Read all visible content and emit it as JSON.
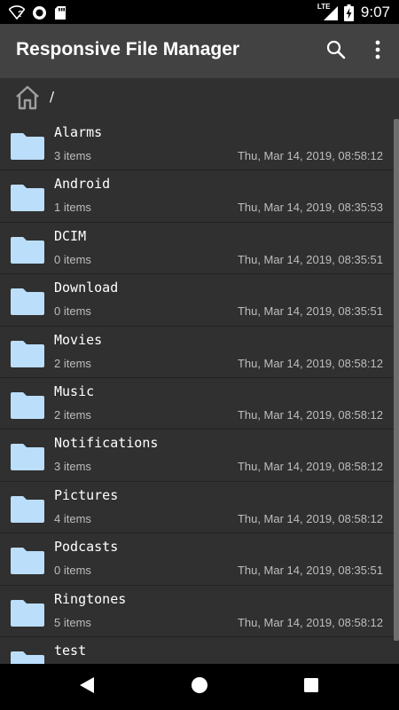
{
  "status_bar": {
    "time": "9:07",
    "network_label": "LTE",
    "wifi_badge": "?",
    "battery_charging": true
  },
  "app_bar": {
    "title": "Responsive File Manager",
    "search_icon": "search-icon",
    "more_icon": "more-vertical-icon"
  },
  "breadcrumb": {
    "home_icon": "home-icon",
    "path": "/"
  },
  "files": [
    {
      "name": "Alarms",
      "count": "3 items",
      "date": "Thu, Mar 14, 2019, 08:58:12"
    },
    {
      "name": "Android",
      "count": "1 items",
      "date": "Thu, Mar 14, 2019, 08:35:53"
    },
    {
      "name": "DCIM",
      "count": "0 items",
      "date": "Thu, Mar 14, 2019, 08:35:51"
    },
    {
      "name": "Download",
      "count": "0 items",
      "date": "Thu, Mar 14, 2019, 08:35:51"
    },
    {
      "name": "Movies",
      "count": "2 items",
      "date": "Thu, Mar 14, 2019, 08:58:12"
    },
    {
      "name": "Music",
      "count": "2 items",
      "date": "Thu, Mar 14, 2019, 08:58:12"
    },
    {
      "name": "Notifications",
      "count": "3 items",
      "date": "Thu, Mar 14, 2019, 08:58:12"
    },
    {
      "name": "Pictures",
      "count": "4 items",
      "date": "Thu, Mar 14, 2019, 08:58:12"
    },
    {
      "name": "Podcasts",
      "count": "0 items",
      "date": "Thu, Mar 14, 2019, 08:35:51"
    },
    {
      "name": "Ringtones",
      "count": "5 items",
      "date": "Thu, Mar 14, 2019, 08:58:12"
    },
    {
      "name": "test",
      "count": "",
      "date": ""
    }
  ],
  "colors": {
    "background": "#303030",
    "app_bar": "#424242",
    "folder": "#bbdefb",
    "secondary_text": "#bdbdbd"
  },
  "nav_bar": {
    "back_icon": "back-triangle-icon",
    "home_icon": "home-circle-icon",
    "recents_icon": "recents-square-icon"
  }
}
